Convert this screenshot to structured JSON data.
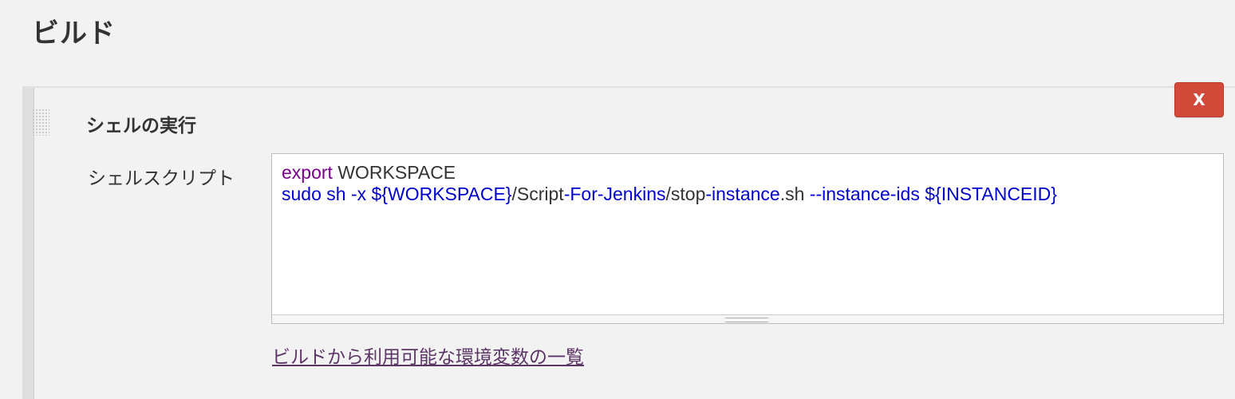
{
  "section": {
    "title": "ビルド"
  },
  "build_step": {
    "title": "シェルの実行",
    "delete_label": "X",
    "field_label": "シェルスクリプト",
    "script_lines": [
      [
        {
          "text": "export",
          "kind": "keyword"
        },
        {
          "text": " WORKSPACE",
          "kind": "plain"
        }
      ],
      [
        {
          "text": "sudo",
          "kind": "builtin"
        },
        {
          "text": " ",
          "kind": "plain"
        },
        {
          "text": "sh",
          "kind": "builtin"
        },
        {
          "text": " ",
          "kind": "plain"
        },
        {
          "text": "-x",
          "kind": "builtin"
        },
        {
          "text": " ",
          "kind": "plain"
        },
        {
          "text": "${WORKSPACE}",
          "kind": "builtin"
        },
        {
          "text": "/Script",
          "kind": "plain"
        },
        {
          "text": "-For-Jenkins",
          "kind": "builtin"
        },
        {
          "text": "/stop",
          "kind": "plain"
        },
        {
          "text": "-instance",
          "kind": "builtin"
        },
        {
          "text": ".sh ",
          "kind": "plain"
        },
        {
          "text": "--instance-ids",
          "kind": "builtin"
        },
        {
          "text": " ",
          "kind": "plain"
        },
        {
          "text": "${INSTANCEID}",
          "kind": "builtin"
        }
      ]
    ],
    "env_link": "ビルドから利用可能な環境変数の一覧"
  },
  "colors": {
    "background": "#f2f2f2",
    "delete_button": "#d24939",
    "keyword": "#770088",
    "builtin": "#0000cc",
    "link": "#5c3566"
  }
}
